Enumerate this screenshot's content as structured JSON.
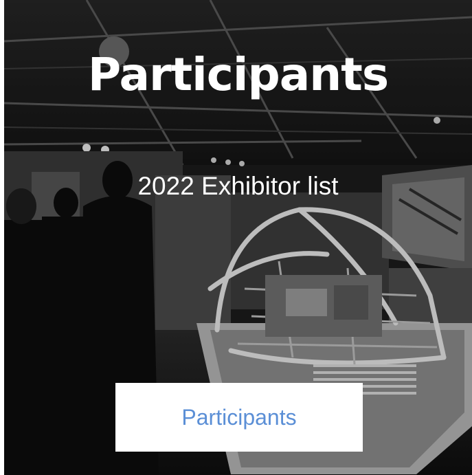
{
  "hero": {
    "title": "Participants",
    "subtitle": "2022 Exhibitor list",
    "button_label": "Participants"
  },
  "colors": {
    "title_text": "#ffffff",
    "button_background": "#ffffff",
    "button_text": "#5b8fd6"
  }
}
